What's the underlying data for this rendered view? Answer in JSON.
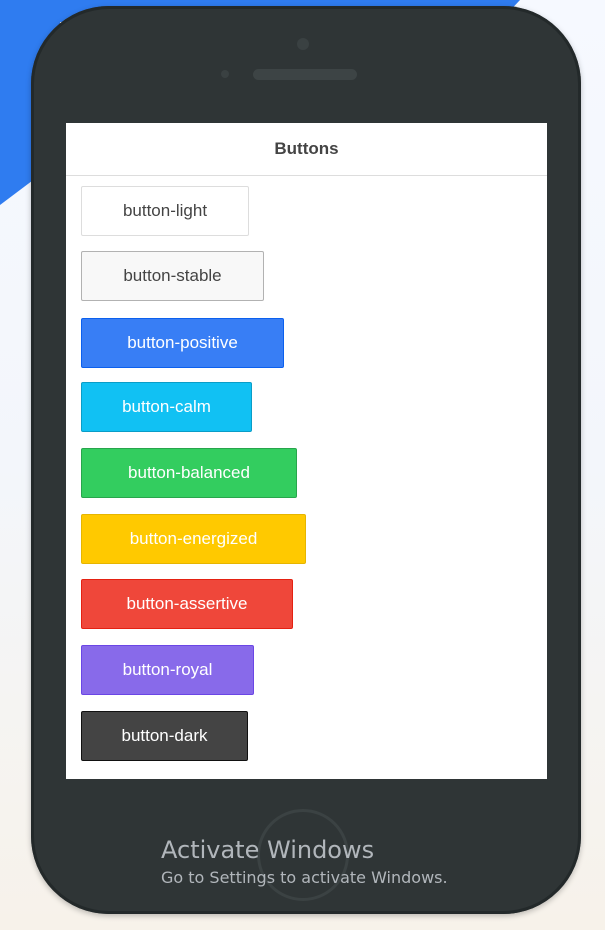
{
  "screen": {
    "header": {
      "title": "Buttons"
    },
    "buttons": [
      {
        "label": "button-light",
        "style": "light",
        "color": "#ffffff"
      },
      {
        "label": "button-stable",
        "style": "stable",
        "color": "#f8f8f8"
      },
      {
        "label": "button-positive",
        "style": "positive",
        "color": "#387ef5"
      },
      {
        "label": "button-calm",
        "style": "calm",
        "color": "#11c1f3"
      },
      {
        "label": "button-balanced",
        "style": "balanced",
        "color": "#33cd5f"
      },
      {
        "label": "button-energized",
        "style": "energized",
        "color": "#ffc900"
      },
      {
        "label": "button-assertive",
        "style": "assertive",
        "color": "#ef473a"
      },
      {
        "label": "button-royal",
        "style": "royal",
        "color": "#886aea"
      },
      {
        "label": "button-dark",
        "style": "dark",
        "color": "#444444"
      }
    ]
  },
  "watermark": {
    "title": "Activate Windows",
    "subtitle": "Go to Settings to activate Windows."
  },
  "colors": {
    "phone_body": "#2f3536",
    "background_accent": "#2f7cf0"
  }
}
